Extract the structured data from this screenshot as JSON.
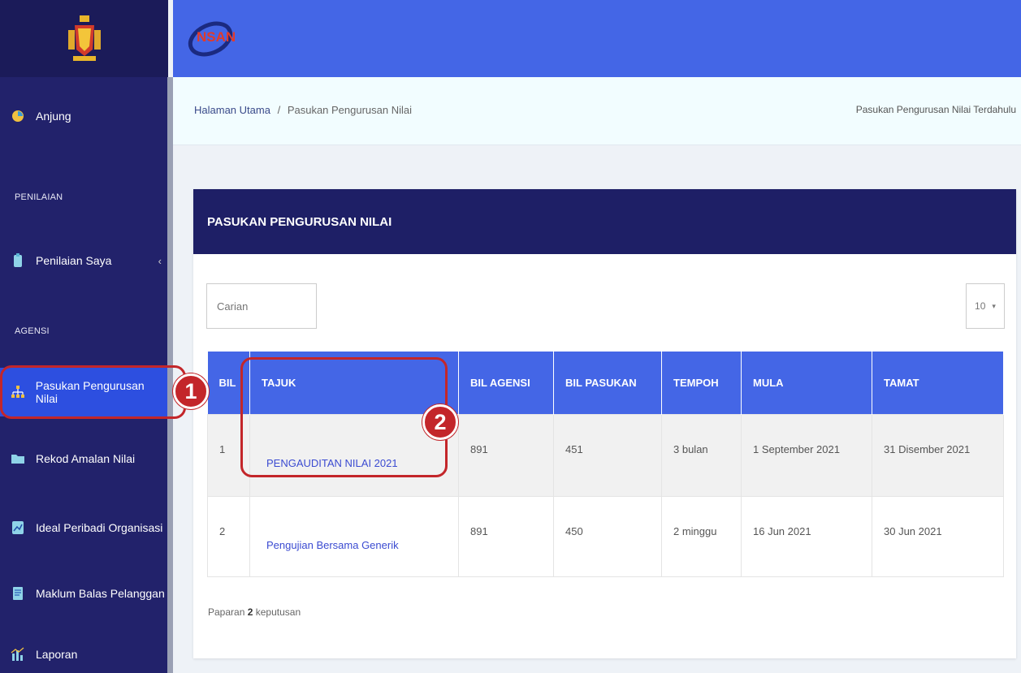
{
  "sidebar": {
    "items": [
      {
        "label": "Anjung",
        "icon": "dashboard-icon"
      },
      {
        "label": "Penilaian Saya",
        "icon": "clipboard-icon"
      },
      {
        "label": "Pasukan Pengurusan Nilai",
        "icon": "sitemap-icon"
      },
      {
        "label": "Rekod Amalan Nilai",
        "icon": "folder-icon"
      },
      {
        "label": "Ideal Peribadi Organisasi",
        "icon": "chart-icon"
      },
      {
        "label": "Maklum Balas Pelanggan",
        "icon": "document-icon"
      },
      {
        "label": "Laporan",
        "icon": "bar-chart-icon"
      }
    ],
    "sections": {
      "penilaian": "PENILAIAN",
      "agensi": "AGENSI"
    },
    "chevron": "‹"
  },
  "header": {
    "logo_text": "NSAN"
  },
  "breadcrumb": {
    "home": "Halaman Utama",
    "separator": "/",
    "current": "Pasukan Pengurusan Nilai",
    "previous_link": "Pasukan Pengurusan Nilai Terdahulu"
  },
  "card": {
    "title": "PASUKAN PENGURUSAN NILAI",
    "search_placeholder": "Carian",
    "page_size": "10",
    "columns": [
      "BIL",
      "TAJUK",
      "BIL AGENSI",
      "BIL PASUKAN",
      "TEMPOH",
      "MULA",
      "TAMAT"
    ],
    "rows": [
      [
        "1",
        "PENGAUDITAN NILAI 2021",
        "891",
        "451",
        "3 bulan",
        "1 September 2021",
        "31 Disember 2021"
      ],
      [
        "2",
        "Pengujian Bersama Generik",
        "891",
        "450",
        "2 minggu",
        "16 Jun 2021",
        "30 Jun 2021"
      ]
    ],
    "summary_prefix": "Paparan",
    "summary_count": "2",
    "summary_suffix": "keputusan"
  },
  "annotations": {
    "step1": "1",
    "step2": "2"
  },
  "colors": {
    "sidebar": "#22226b",
    "topbar": "#4466e6",
    "active": "#2d4fe0",
    "card_head": "#1e1f66",
    "highlight": "#c3262a"
  }
}
